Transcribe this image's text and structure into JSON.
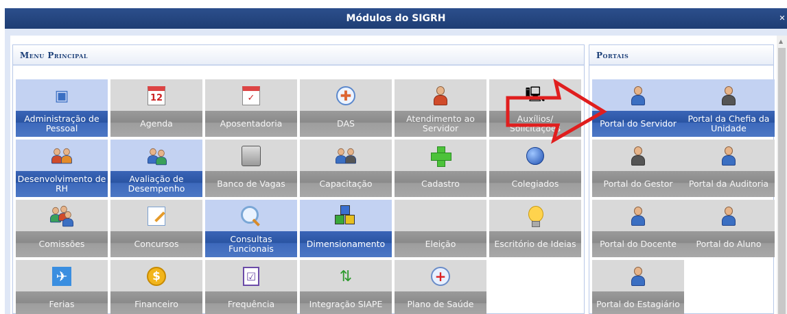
{
  "window": {
    "title": "Módulos do SIGRH"
  },
  "menu_principal": {
    "header": "Menu Principal",
    "tiles": [
      {
        "label": "Administração de Pessoal",
        "icon": "admin-pessoal-icon",
        "highlight": true
      },
      {
        "label": "Agenda",
        "icon": "calendar-icon",
        "highlight": false
      },
      {
        "label": "Aposentadoria",
        "icon": "calendar-check-icon",
        "highlight": false
      },
      {
        "label": "DAS",
        "icon": "das-icon",
        "highlight": false
      },
      {
        "label": "Atendimento ao Servidor",
        "icon": "support-agent-icon",
        "highlight": false
      },
      {
        "label": "Auxílios/ Solicitações",
        "icon": "computer-request-icon",
        "highlight": false
      },
      {
        "label": "Desenvolvimento de RH",
        "icon": "people-icon",
        "highlight": true
      },
      {
        "label": "Avaliação de Desempenho",
        "icon": "evaluation-icon",
        "highlight": true
      },
      {
        "label": "Banco de Vagas",
        "icon": "database-icon",
        "highlight": false
      },
      {
        "label": "Capacitação",
        "icon": "training-icon",
        "highlight": false
      },
      {
        "label": "Cadastro",
        "icon": "plus-icon",
        "highlight": false
      },
      {
        "label": "Colegiados",
        "icon": "globe-icon",
        "highlight": false
      },
      {
        "label": "Comissões",
        "icon": "group-icon",
        "highlight": false
      },
      {
        "label": "Concursos",
        "icon": "pencil-document-icon",
        "highlight": false
      },
      {
        "label": "Consultas Funcionais",
        "icon": "magnifier-icon",
        "highlight": true
      },
      {
        "label": "Dimensionamento",
        "icon": "cubes-icon",
        "highlight": true
      },
      {
        "label": "Eleição",
        "icon": "",
        "highlight": false
      },
      {
        "label": "Escritório de Ideias",
        "icon": "lightbulb-icon",
        "highlight": false
      },
      {
        "label": "Ferias",
        "icon": "airplane-icon",
        "highlight": false
      },
      {
        "label": "Financeiro",
        "icon": "coin-icon",
        "highlight": false
      },
      {
        "label": "Frequência",
        "icon": "checklist-icon",
        "highlight": false
      },
      {
        "label": "Integração SIAPE",
        "icon": "sync-arrows-icon",
        "highlight": false
      },
      {
        "label": "Plano de Saúde",
        "icon": "health-cross-icon",
        "highlight": false
      }
    ]
  },
  "portais": {
    "header": "Portais",
    "tiles": [
      {
        "label": "Portal do Servidor",
        "icon": "servidor-icon",
        "highlight": true
      },
      {
        "label": "Portal da Chefia da Unidade",
        "icon": "chefia-icon",
        "highlight": true
      },
      {
        "label": "Portal do Gestor",
        "icon": "gestor-icon",
        "highlight": false
      },
      {
        "label": "Portal da Auditoria",
        "icon": "auditoria-icon",
        "highlight": false
      },
      {
        "label": "Portal do Docente",
        "icon": "docente-icon",
        "highlight": false
      },
      {
        "label": "Portal do Aluno",
        "icon": "aluno-icon",
        "highlight": false
      },
      {
        "label": "Portal do Estagiário",
        "icon": "estagiario-icon",
        "highlight": false
      }
    ]
  },
  "colors": {
    "title_bar": "#1e3d74",
    "highlight_label": "#2a54a2",
    "gray_label": "#8a8a8a",
    "annotation_arrow": "#e01e1e"
  }
}
